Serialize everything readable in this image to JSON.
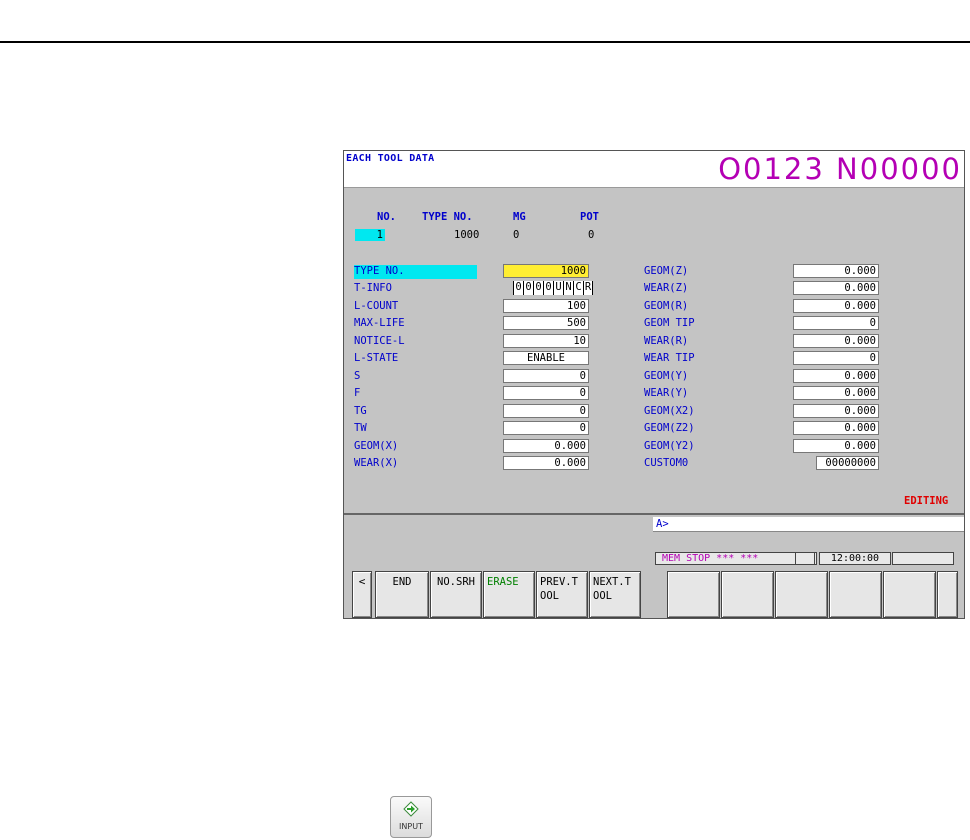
{
  "screen": {
    "title": "EACH TOOL DATA",
    "program": "O0123 N00000",
    "header_labels": {
      "no": "NO.",
      "type_no": "TYPE NO.",
      "mg": "MG",
      "pot": "POT"
    },
    "header_values": {
      "no": "1",
      "type_no": "1000",
      "mg": "0",
      "pot": "0"
    },
    "left_params": [
      {
        "label": "TYPE NO.",
        "value": "1000"
      },
      {
        "label": "T-INFO",
        "value": ""
      },
      {
        "label": "L-COUNT",
        "value": "100"
      },
      {
        "label": "MAX-LIFE",
        "value": "500"
      },
      {
        "label": "NOTICE-L",
        "value": "10"
      },
      {
        "label": "L-STATE",
        "value": "ENABLE"
      },
      {
        "label": "S",
        "value": "0"
      },
      {
        "label": "F",
        "value": "0"
      },
      {
        "label": "TG",
        "value": "0"
      },
      {
        "label": "TW",
        "value": "0"
      },
      {
        "label": "GEOM(X)",
        "value": "0.000"
      },
      {
        "label": "WEAR(X)",
        "value": "0.000"
      }
    ],
    "tinfo_chars": [
      "0",
      "0",
      "0",
      "0",
      "U",
      "N",
      "C",
      "R"
    ],
    "right_params": [
      {
        "label": "GEOM(Z)",
        "value": "0.000"
      },
      {
        "label": "WEAR(Z)",
        "value": "0.000"
      },
      {
        "label": "GEOM(R)",
        "value": "0.000"
      },
      {
        "label": "GEOM TIP",
        "value": "0"
      },
      {
        "label": "WEAR(R)",
        "value": "0.000"
      },
      {
        "label": "WEAR TIP",
        "value": "0"
      },
      {
        "label": "GEOM(Y)",
        "value": "0.000"
      },
      {
        "label": "WEAR(Y)",
        "value": "0.000"
      },
      {
        "label": "GEOM(X2)",
        "value": "0.000"
      },
      {
        "label": "GEOM(Z2)",
        "value": "0.000"
      },
      {
        "label": "GEOM(Y2)",
        "value": "0.000"
      },
      {
        "label": "CUSTOM0",
        "value": "00000000"
      }
    ],
    "mode_text": "EDITING",
    "key_input_prompt": "A>",
    "status_text": "MEM  STOP *** ***",
    "clock": "12:00:00",
    "softkeys": {
      "prev": "<",
      "end": "END",
      "no_srh": "NO.SRH",
      "erase": "ERASE",
      "prev_tool": "PREV.T\nOOL",
      "next_tool": "NEXT.T\nOOL"
    }
  },
  "input_key": {
    "label": "INPUT"
  },
  "colors": {
    "label_blue": "#0000cc",
    "program_magenta": "#b400b4",
    "cursor_cyan": "#00e8f0",
    "highlight_yellow": "#ffee33",
    "editing_red": "#e00000",
    "erase_green": "#008000"
  }
}
